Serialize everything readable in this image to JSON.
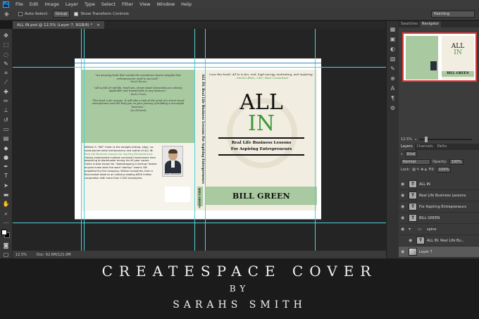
{
  "menubar": {
    "logo": "Ps",
    "items": [
      "File",
      "Edit",
      "Image",
      "Layer",
      "Type",
      "Select",
      "Filter",
      "View",
      "Window",
      "Help"
    ]
  },
  "options": {
    "auto_select_label": "Auto-Select:",
    "auto_select_value": "Group",
    "transform_label": "Show Transform Controls",
    "workspace": "Painting"
  },
  "document": {
    "tab_title": "ALL IN.psd @ 12.5% (Layer 7, RGB/8) *",
    "close_glyph": "×"
  },
  "status": {
    "zoom": "12.5%",
    "doc_size": "Doc: 62.6M/121.0M"
  },
  "cover": {
    "back": {
      "quotes": [
        {
          "text": "\"An amazing book that reveals the sometimes elusive insights that entrepreneurs need to succeed.\"",
          "author": "- David Brown,"
        },
        {
          "text": "\"All so full of real-life, hard-won, street-smart knowwhat are entirely applicable and transferable to any business.\"",
          "author": "- Kevin Travis,"
        },
        {
          "text": "\"This book is for anyone. It will take a look at the mind of a street smart entrepreneur and will help you on your journey of building a successful business.\"",
          "author": "- Jon Richards,"
        }
      ],
      "bio_lead": "William S. \"Bill\" Green is the straight-talking, edgy, no-holds-barred serial entrepreneur and author of ALL IN: ",
      "bio_highlight": "Real Life Business Lessons for Aspiring Entrepreneurs.",
      "bio_rest": " Having shepherded multiple successful businesses from beginning to blockbuster during his 40-year career, Green is best known for \"bootstrapping a startup\" before anyone knew what the word \"startup\" meant. Bill propelled his first company, Wilmar Industries, from a flea-market table to an industry-leading $630 million corporation with more than 2,500 employees.",
      "photo_caption": "Photo: Bill Green"
    },
    "spine": {
      "title": "ALL IN: Real Life Business Lessons For Aspiring Entrepreneurs",
      "author": "BILL GREEN"
    },
    "front": {
      "quote": "Love this book! All In is fun, real, high-energy, motivating, and inspiring. ",
      "quote_author": "– Martin Blain, CEO, Blair Consultant",
      "title_1": "ALL",
      "title_2": "IN",
      "subtitle_1": "Real Life Business Lessons",
      "subtitle_2": "For Aspiring Entrepreneurs",
      "author": "BILL GREEN"
    }
  },
  "navigator": {
    "tabs": [
      "Swatches",
      "Navigator"
    ],
    "zoom": "12.5%",
    "thumb_title_1": "ALL",
    "thumb_title_2": "IN",
    "thumb_author": "BILL GREEN"
  },
  "layers": {
    "tabs": [
      "Layers",
      "Channels",
      "Paths"
    ],
    "kind": "Kind",
    "blend_mode": "Normal",
    "opacity_label": "Opacity:",
    "opacity": "100%",
    "lock_label": "Lock:",
    "fill_label": "Fill:",
    "fill": "100%",
    "items": [
      {
        "type": "text",
        "name": "ALL IN"
      },
      {
        "type": "text",
        "name": "Real Life Business Lessons"
      },
      {
        "type": "text",
        "name": "For Aspiring Entrepreneurs"
      },
      {
        "type": "text",
        "name": "BILL GREEN"
      },
      {
        "type": "group",
        "name": "spine"
      },
      {
        "type": "text",
        "name": "ALL IN: Real Life Bu..."
      },
      {
        "type": "image",
        "name": "Layer 7"
      }
    ]
  },
  "banner": {
    "line1": "CREATESPACE COVER",
    "line2": "BY",
    "line3": "SARAHS SMITH"
  },
  "colors": {
    "accent_green": "#3e9a3a",
    "panel_green": "#a9c9a0",
    "guide": "#4fd1d6"
  }
}
